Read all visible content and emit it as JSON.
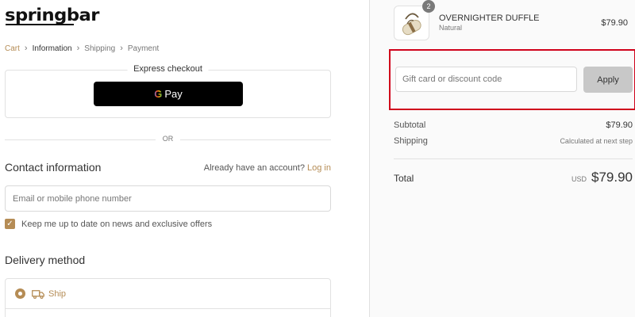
{
  "brand": {
    "name": "springbar"
  },
  "breadcrumb": [
    {
      "label": "Cart"
    },
    {
      "label": "Information"
    },
    {
      "label": "Shipping"
    },
    {
      "label": "Payment"
    }
  ],
  "express": {
    "title": "Express checkout",
    "gpay_g": "G",
    "gpay_label": "Pay"
  },
  "divider_text": "OR",
  "contact": {
    "heading": "Contact information",
    "login_prompt": "Already have an account?",
    "login_link": "Log in",
    "email_placeholder": "Email or mobile phone number",
    "email_value": "",
    "newsletter_label": "Keep me up to date on news and exclusive offers",
    "newsletter_checked": true
  },
  "delivery": {
    "heading": "Delivery method",
    "ship_label": "Ship"
  },
  "order": {
    "item": {
      "name": "OVERNIGHTER DUFFLE",
      "variant": "Natural",
      "price": "$79.90",
      "quantity": "2"
    },
    "discount": {
      "placeholder": "Gift card or discount code",
      "value": "",
      "apply_label": "Apply"
    },
    "subtotal_label": "Subtotal",
    "subtotal_value": "$79.90",
    "shipping_label": "Shipping",
    "shipping_value": "Calculated at next step",
    "total_label": "Total",
    "currency": "USD",
    "total_value": "$79.90"
  },
  "colors": {
    "accent": "#b58c55",
    "highlight": "#d0021b",
    "apply_bg": "#c8c8c8"
  }
}
